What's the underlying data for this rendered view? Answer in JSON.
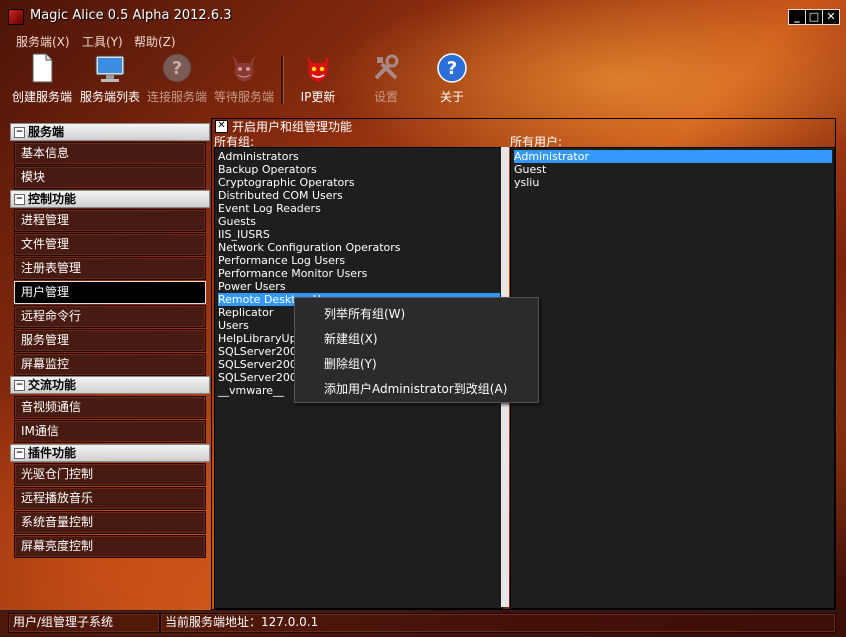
{
  "window": {
    "title": "Magic Alice 0.5 Alpha 2012.6.3",
    "buttons": [
      "_",
      "□",
      "✕"
    ]
  },
  "menu": [
    "服务端(X)",
    "工具(Y)",
    "帮助(Z)"
  ],
  "toolbar": [
    {
      "label": "创建服务端",
      "icon": "document-icon",
      "enabled": true
    },
    {
      "label": "服务端列表",
      "icon": "monitor-icon",
      "enabled": true
    },
    {
      "label": "连接服务端",
      "icon": "help-circle-icon",
      "enabled": false
    },
    {
      "label": "等待服务端",
      "icon": "devil-icon",
      "enabled": false
    },
    {
      "label": "IP更新",
      "icon": "devil-icon",
      "enabled": true
    },
    {
      "label": "设置",
      "icon": "tools-icon",
      "enabled": false
    },
    {
      "label": "关于",
      "icon": "help-circle-icon",
      "enabled": true
    }
  ],
  "sidebar": {
    "sections": [
      {
        "title": "服务端",
        "items": [
          "基本信息",
          "模块"
        ]
      },
      {
        "title": "控制功能",
        "items": [
          "进程管理",
          "文件管理",
          "注册表管理",
          "用户管理",
          "远程命令行",
          "服务管理",
          "屏幕监控"
        ]
      },
      {
        "title": "交流功能",
        "items": [
          "音视频通信",
          "IM通信"
        ]
      },
      {
        "title": "插件功能",
        "items": [
          "光驱仓门控制",
          "远程播放音乐",
          "系统音量控制",
          "屏幕亮度控制"
        ]
      }
    ],
    "selected": "用户管理"
  },
  "main": {
    "checkbox_mark": "✕",
    "checkbox_label": "开启用户和组管理功能",
    "groups_label": "所有组:",
    "users_label": "所有用户:",
    "groups": [
      "Administrators",
      "Backup Operators",
      "Cryptographic Operators",
      "Distributed COM Users",
      "Event Log Readers",
      "Guests",
      "IIS_IUSRS",
      "Network Configuration Operators",
      "Performance Log Users",
      "Performance Monitor Users",
      "Power Users",
      "Remote Desktop Users",
      "Replicator",
      "Users",
      "HelpLibraryUpdaters",
      "SQLServer2005",
      "SQLServer2005",
      "SQLServer2005",
      "__vmware__"
    ],
    "selected_group": "Remote Desktop Users",
    "users": [
      "Administrator",
      "Guest",
      "ysliu"
    ],
    "selected_user": "Administrator"
  },
  "context_menu": [
    "列举所有组(W)",
    "新建组(X)",
    "删除组(Y)",
    "添加用户Administrator到改组(A)"
  ],
  "status": {
    "left": "用户/组管理子系统",
    "middle": "当前服务端地址：127.0.0.1"
  }
}
